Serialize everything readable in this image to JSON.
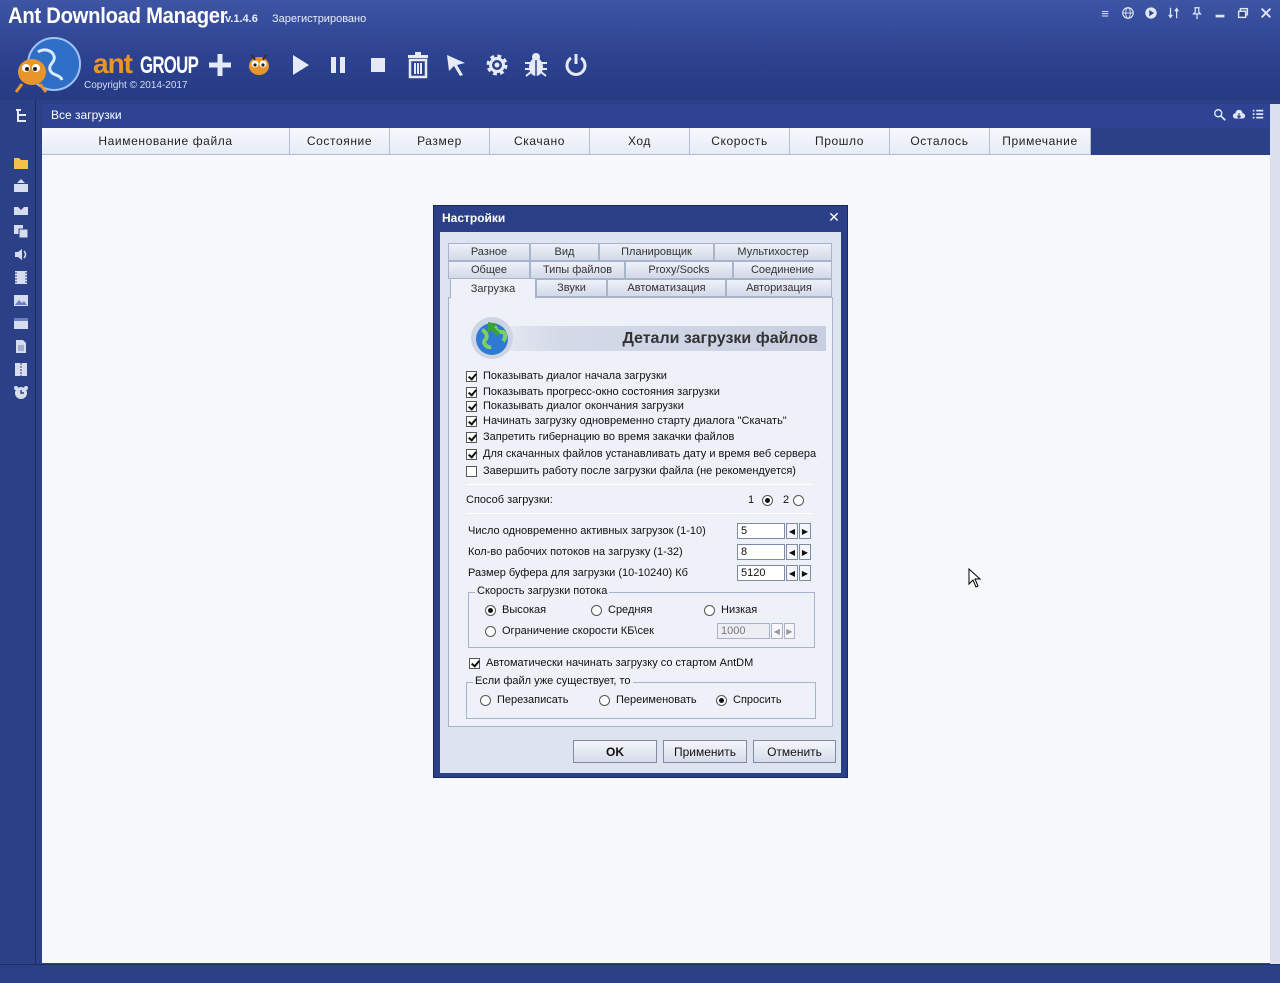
{
  "window": {
    "title": "Ant Download Manager",
    "version": "v.1.4.6",
    "registered": "Зарегистрировано"
  },
  "logo": {
    "name": "ant",
    "group": "GROUP",
    "copyright": "Copyright © 2014-2017"
  },
  "toolbar": [
    "add-icon",
    "ant-download-icon",
    "play-icon",
    "pause-icon",
    "stop-icon",
    "delete-icon",
    "cursor-icon",
    "settings-gear-icon",
    "bug-icon",
    "power-icon"
  ],
  "content": {
    "title": "Все загрузки",
    "columns": [
      "Наименование файла",
      "Состояние",
      "Размер",
      "Скачано",
      "Ход",
      "Скорость",
      "Прошло",
      "Осталось",
      "Примечание"
    ]
  },
  "dialog": {
    "title": "Настройки",
    "tabs_row1": [
      "Разное",
      "Вид",
      "Планировщик",
      "Мультихостер"
    ],
    "tabs_row2": [
      "Общее",
      "Типы файлов",
      "Proxy/Socks",
      "Соединение"
    ],
    "tabs_row3": [
      "Загрузка",
      "Звуки",
      "Автоматизация",
      "Авторизация"
    ],
    "section_title": "Детали загрузки файлов",
    "checkboxes": [
      {
        "label": "Показывать диалог начала загрузки",
        "checked": true
      },
      {
        "label": "Показывать прогресс-окно состояния загрузки",
        "checked": true
      },
      {
        "label": "Показывать диалог окончания загрузки",
        "checked": true
      },
      {
        "label": "Начинать загрузку одновременно старту диалога \"Скачать\"",
        "checked": true
      },
      {
        "label": "Запретить гибернацию во время закачки файлов",
        "checked": true
      },
      {
        "label": "Для скачанных файлов устанавливать дату и время веб сервера",
        "checked": true
      },
      {
        "label": "Завершить работу после загрузки файла (не рекомендуется)",
        "checked": false
      }
    ],
    "method": {
      "label": "Способ загрузки:",
      "opt1": "1",
      "opt2": "2",
      "selected": "1"
    },
    "spinners": [
      {
        "label": "Число одновременно активных загрузок (1-10)",
        "value": "5"
      },
      {
        "label": "Кол-во рабочих потоков на загрузку (1-32)",
        "value": "8"
      },
      {
        "label": "Размер буфера для загрузки (10-10240) Кб",
        "value": "5120"
      }
    ],
    "speed_group": {
      "legend": "Скорость загрузки потока",
      "high": "Высокая",
      "medium": "Средняя",
      "low": "Низкая",
      "limit": "Ограничение скорости КБ\\сек",
      "limit_value": "1000",
      "selected": "high"
    },
    "autostart": {
      "label": "Автоматически начинать загрузку со стартом AntDM",
      "checked": true
    },
    "exists_group": {
      "legend": "Если файл уже существует, то",
      "overwrite": "Перезаписать",
      "rename": "Переименовать",
      "ask": "Спросить",
      "selected": "ask"
    },
    "buttons": {
      "ok": "OK",
      "apply": "Применить",
      "cancel": "Отменить"
    }
  }
}
